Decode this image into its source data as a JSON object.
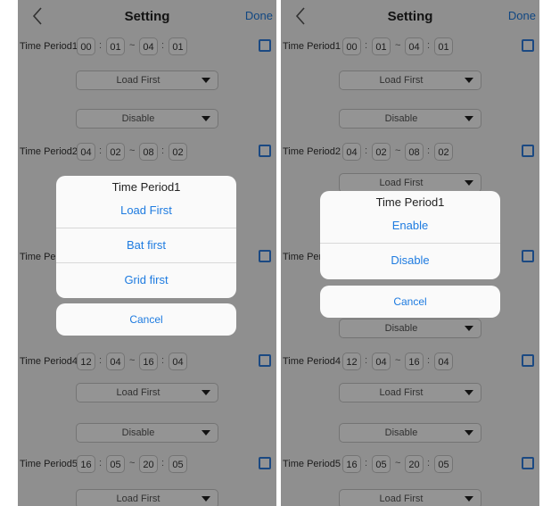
{
  "header": {
    "title": "Setting",
    "done_label": "Done",
    "back_icon": "chevron-left-icon"
  },
  "periods": [
    {
      "label": "Time Period1",
      "start_h": "00",
      "start_m": "01",
      "end_h": "04",
      "end_m": "01"
    },
    {
      "label": "Time Period2",
      "start_h": "04",
      "start_m": "02",
      "end_h": "08",
      "end_m": "02"
    },
    {
      "label": "Time Period4",
      "start_h": "12",
      "start_m": "04",
      "end_h": "16",
      "end_m": "04"
    },
    {
      "label": "Time Period5",
      "start_h": "16",
      "start_m": "05",
      "end_h": "20",
      "end_m": "05"
    }
  ],
  "partial_label": "Time Per",
  "separators": {
    "colon": ":",
    "dash": "~"
  },
  "selects": {
    "load_first": "Load First",
    "disable": "Disable"
  },
  "left_dialog": {
    "title": "Time Period1",
    "options": [
      "Load First",
      "Bat first",
      "Grid first"
    ],
    "cancel": "Cancel"
  },
  "right_dialog": {
    "title": "Time Period1",
    "options": [
      "Enable",
      "Disable"
    ],
    "cancel": "Cancel"
  },
  "colors": {
    "accent": "#1e7be0",
    "overlay": "rgba(0,0,0,0.42)"
  }
}
